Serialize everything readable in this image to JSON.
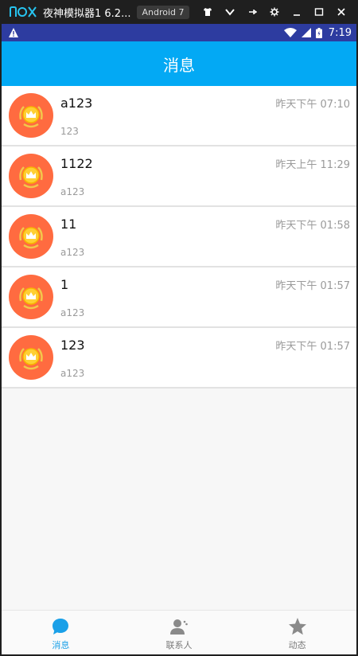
{
  "emulator": {
    "logo": "nox",
    "title": "夜神模拟器1 6.2...",
    "version": "Android 7"
  },
  "status_bar": {
    "time": "7:19"
  },
  "app_bar": {
    "title": "消息"
  },
  "conversations": [
    {
      "name": "a123",
      "message": "123",
      "time": "昨天下午 07:10"
    },
    {
      "name": "1122",
      "message": "a123",
      "time": "昨天上午 11:29"
    },
    {
      "name": "11",
      "message": "a123",
      "time": "昨天下午 01:58"
    },
    {
      "name": "1",
      "message": "a123",
      "time": "昨天下午 01:57"
    },
    {
      "name": "123",
      "message": "a123",
      "time": "昨天下午 01:57"
    }
  ],
  "bottom_nav": {
    "items": [
      {
        "label": "消息",
        "icon": "chat-bubble-icon",
        "active": true
      },
      {
        "label": "联系人",
        "icon": "contacts-icon",
        "active": false
      },
      {
        "label": "动态",
        "icon": "star-icon",
        "active": false
      }
    ]
  },
  "colors": {
    "app_bar": "#03a9f4",
    "status_bar": "#2d3ca0",
    "avatar_bg": "#ff6b40",
    "active_tab": "#1aa0e8"
  }
}
